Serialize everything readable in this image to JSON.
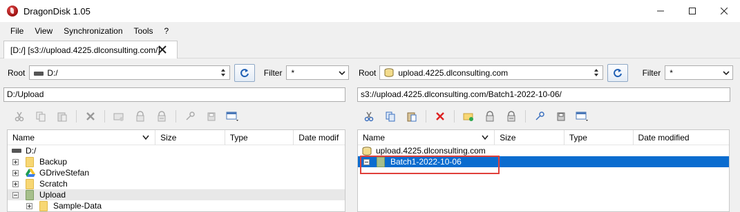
{
  "window": {
    "title": "DragonDisk 1.05",
    "controls": {
      "minimize": "minimize-icon",
      "maximize": "maximize-icon",
      "close": "close-icon"
    }
  },
  "menu": [
    "File",
    "View",
    "Synchronization",
    "Tools",
    "?"
  ],
  "tab": {
    "label": "[D:/] [s3://upload.4225.dlconsulting.com/]"
  },
  "left": {
    "root_label": "Root",
    "root_value": "D:/",
    "filter_label": "Filter",
    "filter_value": "*",
    "path": "D:/Upload",
    "toolbar": [
      "cut-icon",
      "copy-icon",
      "paste-icon",
      "delete-icon",
      "new-folder-icon",
      "lock-icon",
      "lock-alt-icon",
      "properties-icon",
      "key-icon",
      "disk-icon",
      "view-menu-icon"
    ],
    "columns": [
      "Name",
      "Size",
      "Type",
      "Date modif"
    ],
    "rows": [
      {
        "name": "D:/",
        "kind": "drive"
      },
      {
        "name": "Backup",
        "kind": "folder",
        "expander": "plus"
      },
      {
        "name": "GDriveStefan",
        "kind": "gdrive",
        "expander": "plus"
      },
      {
        "name": "Scratch",
        "kind": "folder",
        "expander": "plus"
      },
      {
        "name": "Upload",
        "kind": "folder-green",
        "expander": "minus"
      },
      {
        "name": "Sample-Data",
        "kind": "folder",
        "expander": "plus"
      }
    ]
  },
  "right": {
    "root_label": "Root",
    "root_value": "upload.4225.dlconsulting.com",
    "filter_label": "Filter",
    "filter_value": "*",
    "path": "s3://upload.4225.dlconsulting.com/Batch1-2022-10-06/",
    "columns": [
      "Name",
      "Size",
      "Type",
      "Date modified"
    ],
    "rows": [
      {
        "name": "upload.4225.dlconsulting.com",
        "kind": "bucket"
      },
      {
        "name": "Batch1-2022-10-06",
        "kind": "folder-green",
        "expander": "minus",
        "selected": true
      }
    ]
  },
  "colors": {
    "selection": "#0a6ccf",
    "highlight_box": "#e0403a",
    "accent": "#2b6cb0"
  }
}
